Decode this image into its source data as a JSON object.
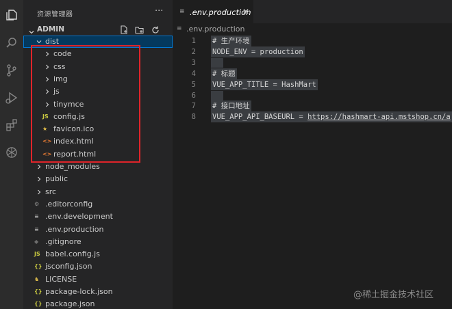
{
  "activity_bar": {
    "icons": [
      "files-icon",
      "search-icon",
      "source-control-icon",
      "run-debug-icon",
      "extensions-icon",
      "openai-icon"
    ]
  },
  "sidebar": {
    "title": "资源管理器",
    "more": "···",
    "section": {
      "label": "ADMIN"
    },
    "items": [
      {
        "label": "dist",
        "type": "folder",
        "expanded": true,
        "level": 1,
        "selected": true
      },
      {
        "label": "code",
        "type": "folder",
        "level": 2
      },
      {
        "label": "css",
        "type": "folder",
        "level": 2
      },
      {
        "label": "img",
        "type": "folder",
        "level": 2
      },
      {
        "label": "js",
        "type": "folder",
        "level": 2
      },
      {
        "label": "tinymce",
        "type": "folder",
        "level": 2
      },
      {
        "label": "config.js",
        "type": "js",
        "icon_text": "JS",
        "level": 2
      },
      {
        "label": "favicon.ico",
        "type": "star",
        "icon_text": "★",
        "level": 2
      },
      {
        "label": "index.html",
        "type": "html",
        "icon_text": "<>",
        "level": 2
      },
      {
        "label": "report.html",
        "type": "html",
        "icon_text": "<>",
        "level": 2
      },
      {
        "label": "node_modules",
        "type": "folder",
        "level": 1
      },
      {
        "label": "public",
        "type": "folder",
        "level": 1
      },
      {
        "label": "src",
        "type": "folder",
        "level": 1
      },
      {
        "label": ".editorconfig",
        "type": "gear",
        "icon_text": "⚙",
        "level": 1
      },
      {
        "label": ".env.development",
        "type": "lines",
        "icon_text": "≡",
        "level": 1
      },
      {
        "label": ".env.production",
        "type": "lines",
        "icon_text": "≡",
        "level": 1
      },
      {
        "label": ".gitignore",
        "type": "git",
        "icon_text": "◆",
        "level": 1
      },
      {
        "label": "babel.config.js",
        "type": "js",
        "icon_text": "JS",
        "level": 1
      },
      {
        "label": "jsconfig.json",
        "type": "json",
        "icon_text": "{}",
        "level": 1
      },
      {
        "label": "LICENSE",
        "type": "license",
        "icon_text": "♞",
        "level": 1
      },
      {
        "label": "package-lock.json",
        "type": "json",
        "icon_text": "{}",
        "level": 1
      },
      {
        "label": "package.json",
        "type": "json",
        "icon_text": "{}",
        "level": 1
      }
    ]
  },
  "editor": {
    "tab": {
      "icon": "≡",
      "label": ".env.production",
      "close": "✕"
    },
    "breadcrumb": {
      "icon": "≡",
      "label": ".env.production"
    },
    "lines": [
      {
        "num": "1",
        "text": "# 生产环境"
      },
      {
        "num": "2",
        "text": "NODE_ENV = production"
      },
      {
        "num": "3",
        "text": ""
      },
      {
        "num": "4",
        "text": "# 标题"
      },
      {
        "num": "5",
        "text": "VUE_APP_TITLE = HashMart"
      },
      {
        "num": "6",
        "text": ""
      },
      {
        "num": "7",
        "text": "# 接口地址"
      },
      {
        "num": "8",
        "text": "VUE_APP_API_BASEURL = ",
        "url": "https://hashmart-api.mstshop.cn/a"
      }
    ]
  },
  "colors": {
    "accent": "#0078d4",
    "highlight_box": "#e0242a",
    "selected_bg": "#04395e"
  },
  "watermark": "@稀土掘金技术社区"
}
